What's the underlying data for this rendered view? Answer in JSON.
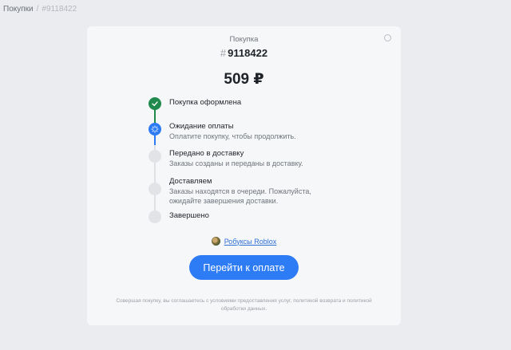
{
  "breadcrumb": {
    "parent": "Покупки",
    "separator": "/",
    "current": "#9118422"
  },
  "card": {
    "kind": "Покупка",
    "order_hash": "#",
    "order_number": "9118422",
    "price": "509 ₽",
    "steps": [
      {
        "title": "Покупка оформлена",
        "description": "",
        "status": "done"
      },
      {
        "title": "Ожидание оплаты",
        "description": "Оплатите покупку, чтобы продолжить.",
        "status": "active"
      },
      {
        "title": "Передано в доставку",
        "description": "Заказы созданы и переданы в доставку.",
        "status": "pending"
      },
      {
        "title": "Доставляем",
        "description": "Заказы находятся в очереди. Пожалуйста, ожидайте завершения доставки.",
        "status": "pending"
      },
      {
        "title": "Завершено",
        "description": "",
        "status": "pending"
      }
    ],
    "product_link": "Робуксы Roblox",
    "pay_button": "Перейти к оплате",
    "agreement": "Совершая покупку, вы соглашаетесь с условиями предоставления услуг, политикой возврата и политикой обработки данных."
  },
  "colors": {
    "done": "#1f8a4c",
    "active": "#2d7cf6",
    "pending": "#e1e3e7"
  },
  "icons": {
    "done": "check-icon",
    "active": "spinner-icon",
    "close": "close-circle-icon",
    "product": "roblox-thumbnail-icon"
  }
}
